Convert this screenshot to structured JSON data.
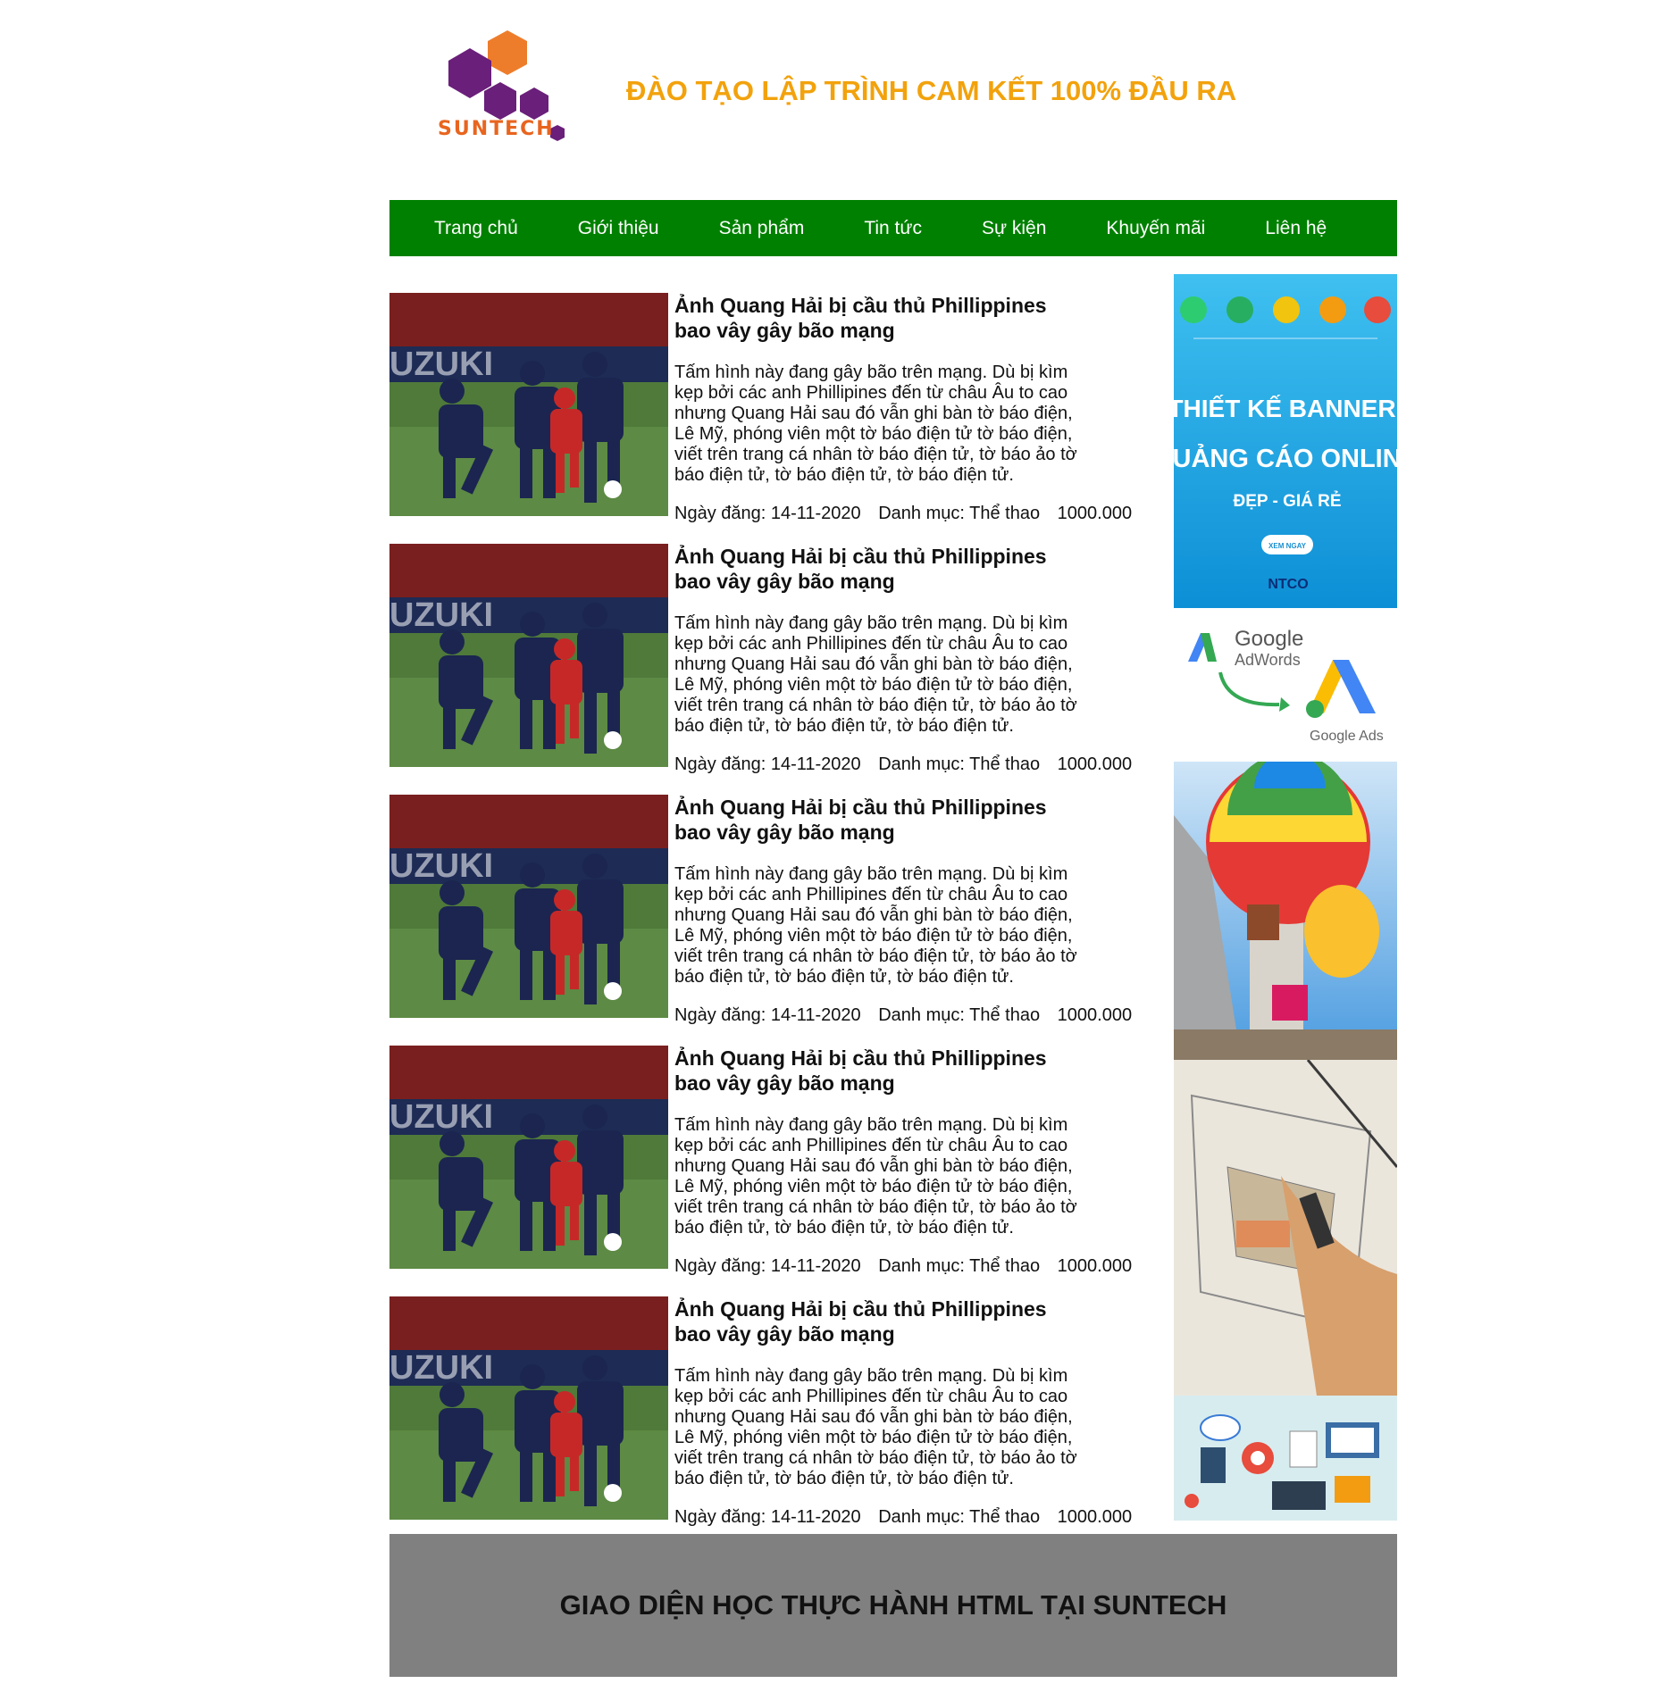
{
  "header": {
    "logo_text": "SUNTECH",
    "tagline": "ĐÀO TẠO LẬP TRÌNH CAM KẾT 100% ĐẦU RA",
    "tagline_color": "#f2a20c"
  },
  "nav": {
    "background": "#008000",
    "items": [
      {
        "label": "Trang chủ"
      },
      {
        "label": "Giới thiệu"
      },
      {
        "label": "Sản phẩm"
      },
      {
        "label": "Tin tức"
      },
      {
        "label": "Sự kiện"
      },
      {
        "label": "Khuyến mãi"
      },
      {
        "label": "Liên hệ"
      }
    ]
  },
  "articles": [
    {
      "title": "Ảnh Quang Hải bị cầu thủ Phillippines bao vây gây bão mạng",
      "body": "Tấm hình này đang gây bão trên mạng. Dù bị kìm kẹp bởi các anh Phillipines đến từ châu Âu to cao nhưng Quang Hải sau đó vẫn ghi bàn tờ báo điện, Lê Mỹ, phóng viên một tờ báo điện tử tờ báo điện, viết trên trang cá nhân tờ báo điện tử, tờ báo ảo tờ báo điện tử, tờ báo điện tử, tờ báo điện tử.",
      "date": "Ngày đăng: 14-11-2020",
      "category": "Danh mục: Thể thao",
      "views": "1000.000",
      "image": "football-photo"
    },
    {
      "title": "Ảnh Quang Hải bị cầu thủ Phillippines bao vây gây bão mạng",
      "body": "Tấm hình này đang gây bão trên mạng. Dù bị kìm kẹp bởi các anh Phillipines đến từ châu Âu to cao nhưng Quang Hải sau đó vẫn ghi bàn tờ báo điện, Lê Mỹ, phóng viên một tờ báo điện tử tờ báo điện, viết trên trang cá nhân tờ báo điện tử, tờ báo ảo tờ báo điện tử, tờ báo điện tử, tờ báo điện tử.",
      "date": "Ngày đăng: 14-11-2020",
      "category": "Danh mục: Thể thao",
      "views": "1000.000",
      "image": "football-photo"
    },
    {
      "title": "Ảnh Quang Hải bị cầu thủ Phillippines bao vây gây bão mạng",
      "body": "Tấm hình này đang gây bão trên mạng. Dù bị kìm kẹp bởi các anh Phillipines đến từ châu Âu to cao nhưng Quang Hải sau đó vẫn ghi bàn tờ báo điện, Lê Mỹ, phóng viên một tờ báo điện tử tờ báo điện, viết trên trang cá nhân tờ báo điện tử, tờ báo ảo tờ báo điện tử, tờ báo điện tử, tờ báo điện tử.",
      "date": "Ngày đăng: 14-11-2020",
      "category": "Danh mục: Thể thao",
      "views": "1000.000",
      "image": "football-photo"
    },
    {
      "title": "Ảnh Quang Hải bị cầu thủ Phillippines bao vây gây bão mạng",
      "body": "Tấm hình này đang gây bão trên mạng. Dù bị kìm kẹp bởi các anh Phillipines đến từ châu Âu to cao nhưng Quang Hải sau đó vẫn ghi bàn tờ báo điện, Lê Mỹ, phóng viên một tờ báo điện tử tờ báo điện, viết trên trang cá nhân tờ báo điện tử, tờ báo ảo tờ báo điện tử, tờ báo điện tử, tờ báo điện tử.",
      "date": "Ngày đăng: 14-11-2020",
      "category": "Danh mục: Thể thao",
      "views": "1000.000",
      "image": "football-photo"
    },
    {
      "title": "Ảnh Quang Hải bị cầu thủ Phillippines bao vây gây bão mạng",
      "body": "Tấm hình này đang gây bão trên mạng. Dù bị kìm kẹp bởi các anh Phillipines đến từ châu Âu to cao nhưng Quang Hải sau đó vẫn ghi bàn tờ báo điện, Lê Mỹ, phóng viên một tờ báo điện tử tờ báo điện, viết trên trang cá nhân tờ báo điện tử, tờ báo ảo tờ báo điện tử, tờ báo điện tử, tờ báo điện tử.",
      "date": "Ngày đăng: 14-11-2020",
      "category": "Danh mục: Thể thao",
      "views": "1000.000",
      "image": "football-photo"
    }
  ],
  "sidebar": {
    "banner": {
      "line1": "THIẾT KẾ BANNER",
      "line2": "QUẢNG CÁO ONLINE",
      "line3": "ĐẸP - GIÁ RẺ",
      "button": "XEM NGAY",
      "brand": "NTCO",
      "background": "#1aa6e6"
    },
    "google_ads": {
      "old_brand": "Google",
      "old_product": "AdWords",
      "new_brand": "Google Ads"
    },
    "balloons_image": "hot-air-balloons-photo",
    "sketch_image": "architecture-sketch-photo",
    "tech_image": "tech-icons-illustration"
  },
  "footer": {
    "text": "GIAO DIỆN HỌC THỰC HÀNH HTML TẠI SUNTECH",
    "background": "#808080"
  }
}
